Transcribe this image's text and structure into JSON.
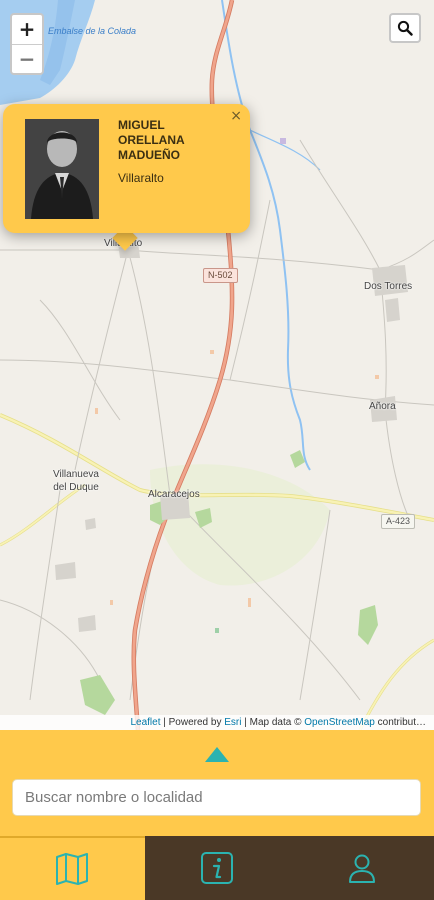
{
  "map": {
    "places": {
      "villaralto": "Villaralto",
      "dos_torres": "Dos Torres",
      "anora": "Añora",
      "villanueva": "Villanueva\ndel Duque",
      "alcaracejos": "Alcaracejos"
    },
    "water_label": "Embalse\nde la Colada",
    "road_labels": {
      "n502": "N-502",
      "a423": "A-423"
    },
    "zoom": {
      "in_label": "+",
      "out_label": "−"
    },
    "search_icon": "magnifier-icon",
    "colors": {
      "background": "#f2efe9",
      "water": "#a5cdf0",
      "river": "#8fc2f2",
      "main_road": "#e8967a",
      "secondary_road": "#f4ec9c",
      "park": "#b5d89d"
    }
  },
  "popup": {
    "name": "MIGUEL ORELLANA MADUEÑO",
    "place": "Villaralto",
    "close_label": "×"
  },
  "attribution": {
    "leaflet": "Leaflet",
    "sep1": " | Powered by ",
    "esri": "Esri",
    "sep2": " | Map data © ",
    "osm": "OpenStreetMap",
    "rest": " contribut…"
  },
  "panel": {
    "search_placeholder": "Buscar nombre o localidad",
    "search_value": "",
    "toggle_icon": "triangle-up-icon"
  },
  "nav": {
    "items": [
      {
        "icon": "map-icon",
        "active": true
      },
      {
        "icon": "info-icon",
        "active": false
      },
      {
        "icon": "user-icon",
        "active": false
      }
    ]
  },
  "theme": {
    "accent": "#ffc94b",
    "teal": "#2bb3b0",
    "dark": "#4a3826"
  }
}
